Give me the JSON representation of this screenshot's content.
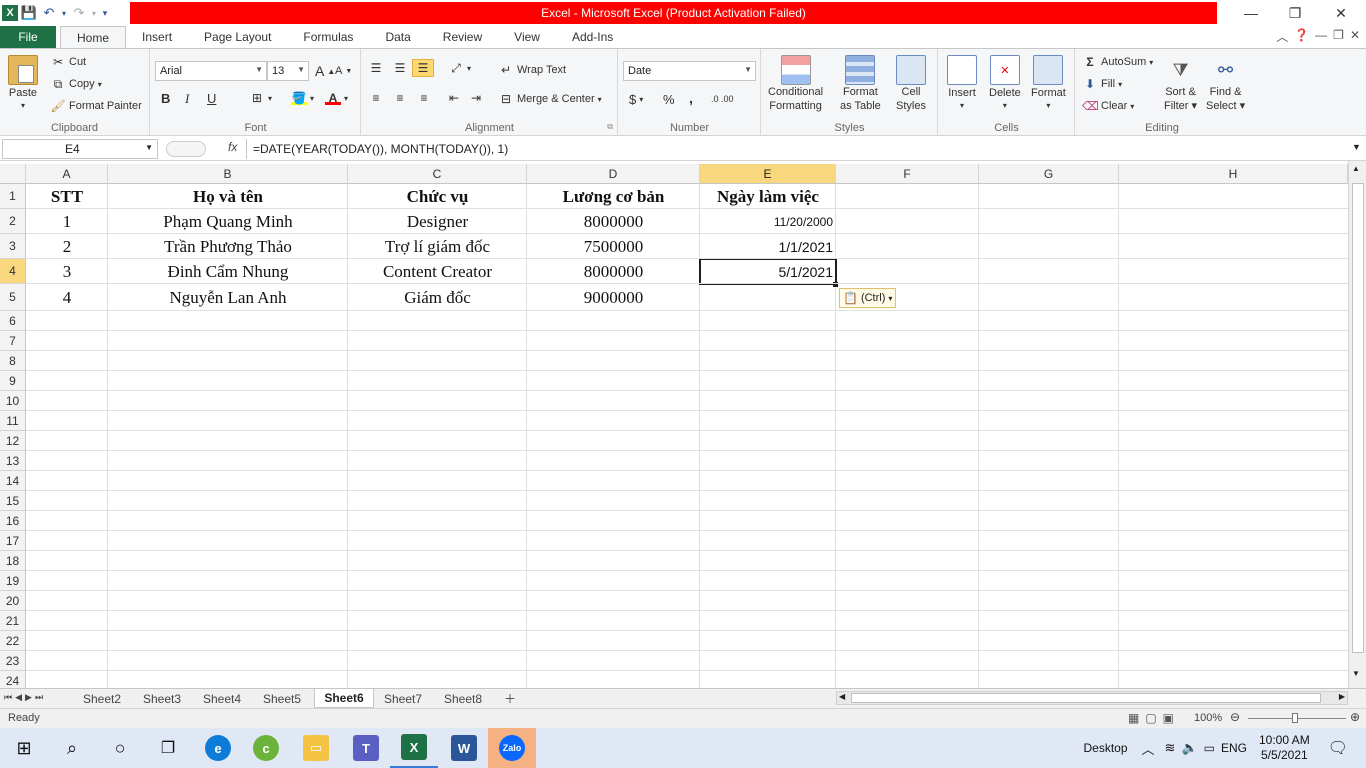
{
  "window": {
    "title": "Excel - Microsoft Excel (Product Activation Failed)",
    "buttons": {
      "minimize": "—",
      "restore": "❐",
      "close": "✕"
    }
  },
  "ribbon_tabs": [
    "File",
    "Home",
    "Insert",
    "Page Layout",
    "Formulas",
    "Data",
    "Review",
    "View",
    "Add-Ins"
  ],
  "ribbon": {
    "clipboard": {
      "paste": "Paste",
      "cut": "Cut",
      "copy": "Copy",
      "format_painter": "Format Painter",
      "label": "Clipboard"
    },
    "font": {
      "name": "Arial",
      "size": "13",
      "bold": "B",
      "italic": "I",
      "underline": "U",
      "label": "Font"
    },
    "alignment": {
      "wrap": "Wrap Text",
      "merge": "Merge & Center",
      "label": "Alignment"
    },
    "number": {
      "format": "Date",
      "currency": "$",
      "percent": "%",
      "comma": ",",
      "inc": ".0 .00",
      "label": "Number"
    },
    "styles": {
      "conditional": "Conditional",
      "conditional2": "Formatting",
      "format_table": "Format",
      "format_table2": "as Table",
      "cell_styles": "Cell",
      "cell_styles2": "Styles",
      "label": "Styles"
    },
    "cells": {
      "insert": "Insert",
      "delete": "Delete",
      "format": "Format",
      "label": "Cells"
    },
    "editing": {
      "autosum": "AutoSum",
      "fill": "Fill",
      "clear": "Clear",
      "sort": "Sort &",
      "sort2": "Filter",
      "find": "Find &",
      "find2": "Select",
      "label": "Editing"
    }
  },
  "formula_bar": {
    "name_box": "E4",
    "fx": "fx",
    "formula": "=DATE(YEAR(TODAY()), MONTH(TODAY()), 1)"
  },
  "columns": [
    "A",
    "B",
    "C",
    "D",
    "E",
    "F",
    "G",
    "H"
  ],
  "rows": [
    "1",
    "2",
    "3",
    "4",
    "5",
    "6",
    "7",
    "8",
    "9",
    "10",
    "11",
    "12",
    "13",
    "14",
    "15",
    "16",
    "17",
    "18",
    "19",
    "20",
    "21",
    "22",
    "23",
    "24"
  ],
  "table": {
    "headers": [
      "STT",
      "Họ và tên",
      "Chức vụ",
      "Lương cơ bản",
      "Ngày làm việc"
    ],
    "rows": [
      [
        "1",
        "Phạm Quang Minh",
        "Designer",
        "8000000",
        "11/20/2000"
      ],
      [
        "2",
        "Trần Phương Thảo",
        "Trợ lí giám đốc",
        "7500000",
        "1/1/2021"
      ],
      [
        "3",
        "Đinh Cẩm Nhung",
        "Content Creator",
        "8000000",
        "5/1/2021"
      ],
      [
        "4",
        "Nguyễn Lan Anh",
        "Giám đốc",
        "9000000",
        ""
      ]
    ]
  },
  "paste_options": "(Ctrl)",
  "sheets": [
    "Sheet2",
    "Sheet3",
    "Sheet4",
    "Sheet5",
    "Sheet6",
    "Sheet7",
    "Sheet8"
  ],
  "active_sheet": "Sheet6",
  "status": {
    "ready": "Ready",
    "zoom": "100%"
  },
  "taskbar": {
    "desktop": "Desktop",
    "lang": "ENG",
    "time": "10:00 AM",
    "date": "5/5/2021",
    "zalo": "Zalo"
  },
  "colors": {
    "file_tab": "#1e7145",
    "title_bar": "#ff0000",
    "selected_header": "#f9d77e"
  }
}
